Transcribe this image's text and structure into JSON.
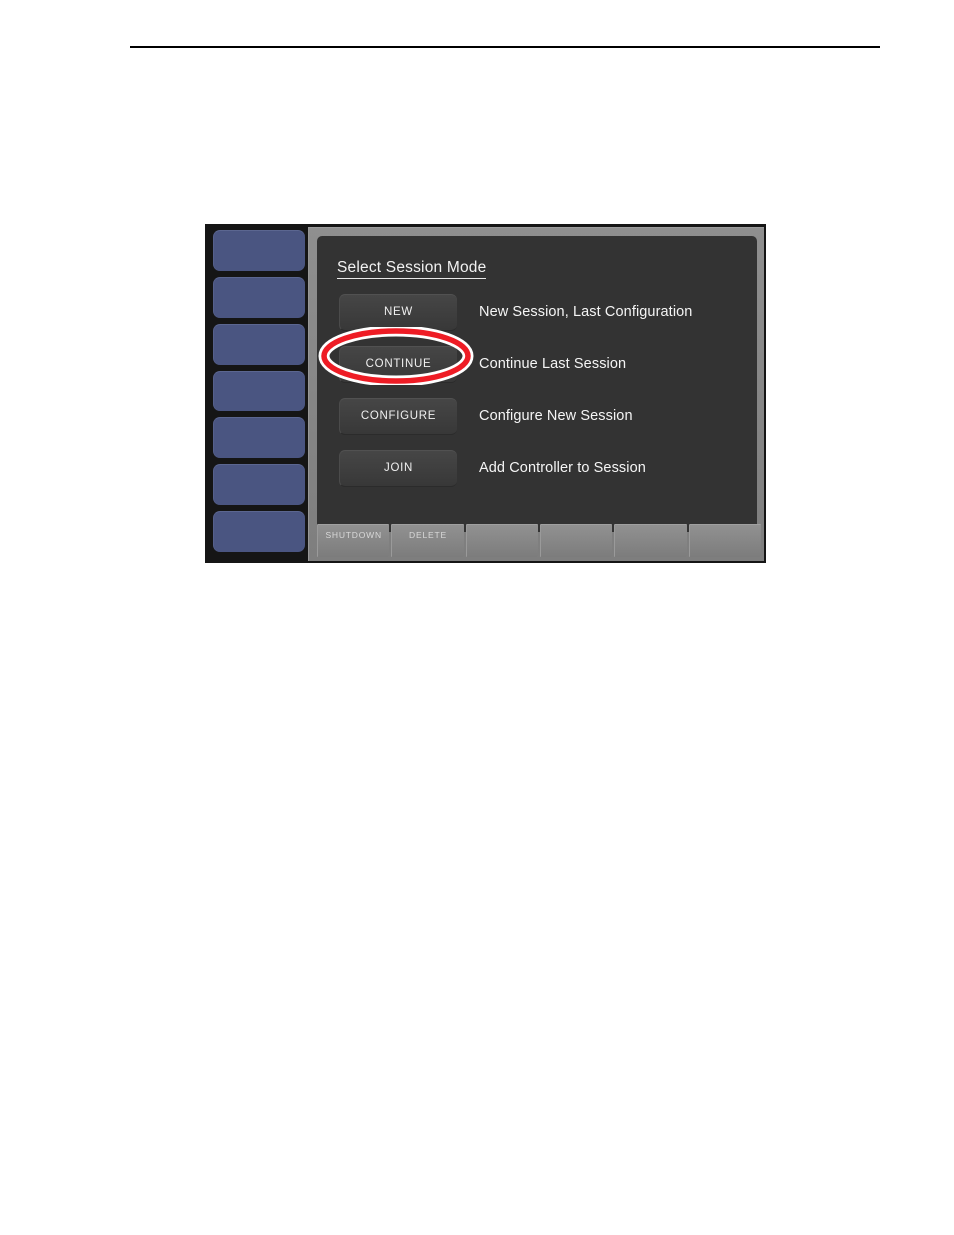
{
  "page": {
    "background_color": "#ffffff",
    "header_rule": true
  },
  "console": {
    "frame_color": "#8a8a8a",
    "screen_background": "#333333",
    "softkey_color": "#4a5581",
    "softkeys": [
      {
        "label": ""
      },
      {
        "label": ""
      },
      {
        "label": ""
      },
      {
        "label": ""
      },
      {
        "label": ""
      },
      {
        "label": ""
      },
      {
        "label": ""
      }
    ],
    "dialog": {
      "title": "Select Session Mode",
      "modes": [
        {
          "button": "NEW",
          "description": "New Session, Last Configuration"
        },
        {
          "button": "CONTINUE",
          "description": "Continue Last Session"
        },
        {
          "button": "CONFIGURE",
          "description": "Configure New Session"
        },
        {
          "button": "JOIN",
          "description": "Add Controller to Session"
        }
      ]
    },
    "bottom_keys": [
      {
        "label": "SHUTDOWN"
      },
      {
        "label": "DELETE"
      },
      {
        "label": ""
      },
      {
        "label": ""
      },
      {
        "label": ""
      },
      {
        "label": ""
      }
    ]
  },
  "annotation": {
    "type": "ellipse-highlight",
    "target": "CONTINUE",
    "ring_color": "#ee1c25",
    "halo_color": "#ffffff"
  }
}
